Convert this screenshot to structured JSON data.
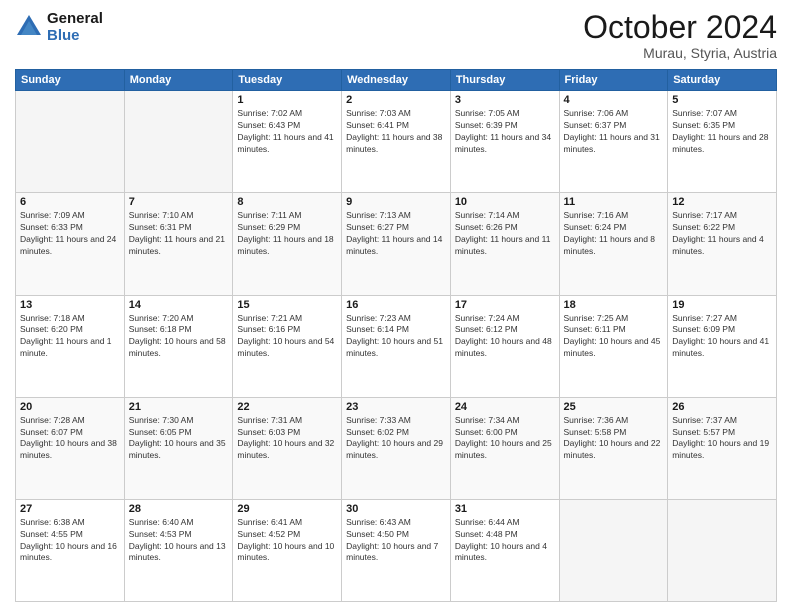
{
  "header": {
    "logo_line1": "General",
    "logo_line2": "Blue",
    "month": "October 2024",
    "location": "Murau, Styria, Austria"
  },
  "weekdays": [
    "Sunday",
    "Monday",
    "Tuesday",
    "Wednesday",
    "Thursday",
    "Friday",
    "Saturday"
  ],
  "weeks": [
    [
      {
        "day": "",
        "info": ""
      },
      {
        "day": "",
        "info": ""
      },
      {
        "day": "1",
        "info": "Sunrise: 7:02 AM\nSunset: 6:43 PM\nDaylight: 11 hours and 41 minutes."
      },
      {
        "day": "2",
        "info": "Sunrise: 7:03 AM\nSunset: 6:41 PM\nDaylight: 11 hours and 38 minutes."
      },
      {
        "day": "3",
        "info": "Sunrise: 7:05 AM\nSunset: 6:39 PM\nDaylight: 11 hours and 34 minutes."
      },
      {
        "day": "4",
        "info": "Sunrise: 7:06 AM\nSunset: 6:37 PM\nDaylight: 11 hours and 31 minutes."
      },
      {
        "day": "5",
        "info": "Sunrise: 7:07 AM\nSunset: 6:35 PM\nDaylight: 11 hours and 28 minutes."
      }
    ],
    [
      {
        "day": "6",
        "info": "Sunrise: 7:09 AM\nSunset: 6:33 PM\nDaylight: 11 hours and 24 minutes."
      },
      {
        "day": "7",
        "info": "Sunrise: 7:10 AM\nSunset: 6:31 PM\nDaylight: 11 hours and 21 minutes."
      },
      {
        "day": "8",
        "info": "Sunrise: 7:11 AM\nSunset: 6:29 PM\nDaylight: 11 hours and 18 minutes."
      },
      {
        "day": "9",
        "info": "Sunrise: 7:13 AM\nSunset: 6:27 PM\nDaylight: 11 hours and 14 minutes."
      },
      {
        "day": "10",
        "info": "Sunrise: 7:14 AM\nSunset: 6:26 PM\nDaylight: 11 hours and 11 minutes."
      },
      {
        "day": "11",
        "info": "Sunrise: 7:16 AM\nSunset: 6:24 PM\nDaylight: 11 hours and 8 minutes."
      },
      {
        "day": "12",
        "info": "Sunrise: 7:17 AM\nSunset: 6:22 PM\nDaylight: 11 hours and 4 minutes."
      }
    ],
    [
      {
        "day": "13",
        "info": "Sunrise: 7:18 AM\nSunset: 6:20 PM\nDaylight: 11 hours and 1 minute."
      },
      {
        "day": "14",
        "info": "Sunrise: 7:20 AM\nSunset: 6:18 PM\nDaylight: 10 hours and 58 minutes."
      },
      {
        "day": "15",
        "info": "Sunrise: 7:21 AM\nSunset: 6:16 PM\nDaylight: 10 hours and 54 minutes."
      },
      {
        "day": "16",
        "info": "Sunrise: 7:23 AM\nSunset: 6:14 PM\nDaylight: 10 hours and 51 minutes."
      },
      {
        "day": "17",
        "info": "Sunrise: 7:24 AM\nSunset: 6:12 PM\nDaylight: 10 hours and 48 minutes."
      },
      {
        "day": "18",
        "info": "Sunrise: 7:25 AM\nSunset: 6:11 PM\nDaylight: 10 hours and 45 minutes."
      },
      {
        "day": "19",
        "info": "Sunrise: 7:27 AM\nSunset: 6:09 PM\nDaylight: 10 hours and 41 minutes."
      }
    ],
    [
      {
        "day": "20",
        "info": "Sunrise: 7:28 AM\nSunset: 6:07 PM\nDaylight: 10 hours and 38 minutes."
      },
      {
        "day": "21",
        "info": "Sunrise: 7:30 AM\nSunset: 6:05 PM\nDaylight: 10 hours and 35 minutes."
      },
      {
        "day": "22",
        "info": "Sunrise: 7:31 AM\nSunset: 6:03 PM\nDaylight: 10 hours and 32 minutes."
      },
      {
        "day": "23",
        "info": "Sunrise: 7:33 AM\nSunset: 6:02 PM\nDaylight: 10 hours and 29 minutes."
      },
      {
        "day": "24",
        "info": "Sunrise: 7:34 AM\nSunset: 6:00 PM\nDaylight: 10 hours and 25 minutes."
      },
      {
        "day": "25",
        "info": "Sunrise: 7:36 AM\nSunset: 5:58 PM\nDaylight: 10 hours and 22 minutes."
      },
      {
        "day": "26",
        "info": "Sunrise: 7:37 AM\nSunset: 5:57 PM\nDaylight: 10 hours and 19 minutes."
      }
    ],
    [
      {
        "day": "27",
        "info": "Sunrise: 6:38 AM\nSunset: 4:55 PM\nDaylight: 10 hours and 16 minutes."
      },
      {
        "day": "28",
        "info": "Sunrise: 6:40 AM\nSunset: 4:53 PM\nDaylight: 10 hours and 13 minutes."
      },
      {
        "day": "29",
        "info": "Sunrise: 6:41 AM\nSunset: 4:52 PM\nDaylight: 10 hours and 10 minutes."
      },
      {
        "day": "30",
        "info": "Sunrise: 6:43 AM\nSunset: 4:50 PM\nDaylight: 10 hours and 7 minutes."
      },
      {
        "day": "31",
        "info": "Sunrise: 6:44 AM\nSunset: 4:48 PM\nDaylight: 10 hours and 4 minutes."
      },
      {
        "day": "",
        "info": ""
      },
      {
        "day": "",
        "info": ""
      }
    ]
  ]
}
